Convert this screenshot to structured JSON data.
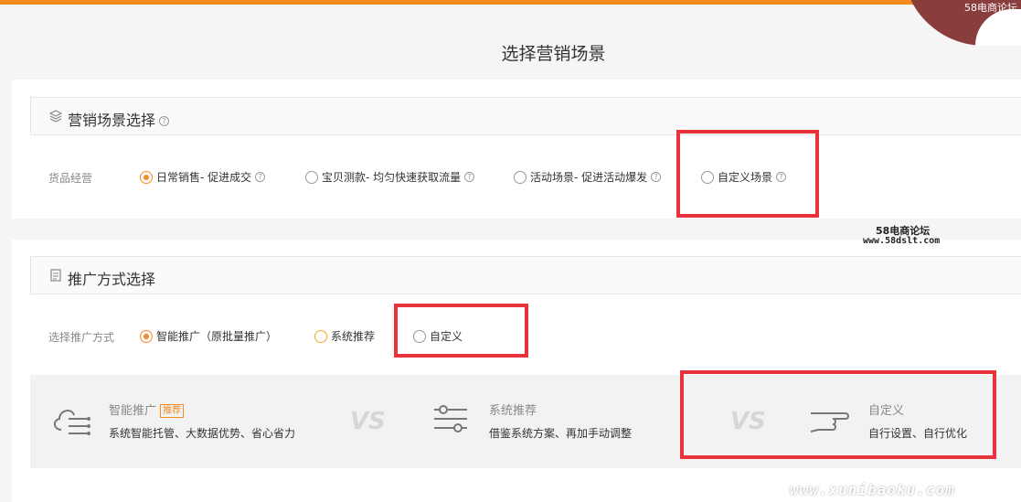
{
  "page_title": "选择营销场景",
  "watermark": {
    "corner": "58电商论坛",
    "mid_line1": "58电商论坛",
    "mid_line2": "www.58dslt.com",
    "bottom": "www.xunibaoku.com"
  },
  "scene_section": {
    "title": "营销场景选择",
    "row_label": "货品经营",
    "options": [
      {
        "label": "日常销售- 促进成交",
        "selected": true
      },
      {
        "label": "宝贝测款- 均匀快速获取流量",
        "selected": false
      },
      {
        "label": "活动场景- 促进活动爆发",
        "selected": false
      },
      {
        "label": "自定义场景",
        "selected": false
      }
    ]
  },
  "promo_section": {
    "title": "推广方式选择",
    "row_label": "选择推广方式",
    "options": [
      {
        "label": "智能推广（原批量推广）",
        "selected": true
      },
      {
        "label": "系统推荐",
        "selected": false
      },
      {
        "label": "自定义",
        "selected": false
      }
    ]
  },
  "compare": {
    "items": [
      {
        "name": "智能推广",
        "tag": "推荐",
        "desc": "系统智能托管、大数据优势、省心省力",
        "icon": "cloud-network-icon"
      },
      {
        "name": "系统推荐",
        "desc": "借鉴系统方案、再加手动调整",
        "icon": "sliders-icon"
      },
      {
        "name": "自定义",
        "desc": "自行设置、自行优化",
        "icon": "hand-pointing-icon"
      }
    ],
    "vs_label": "VS"
  },
  "colors": {
    "accent": "#f58a1f",
    "highlight_box": "#e8333c"
  }
}
